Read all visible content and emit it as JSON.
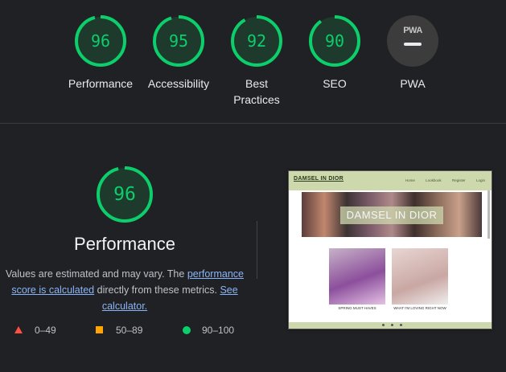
{
  "summary": {
    "categories": [
      {
        "label": "Performance",
        "score": "96",
        "value": 96
      },
      {
        "label": "Accessibility",
        "score": "95",
        "value": 95
      },
      {
        "label": "Best Practices",
        "score": "92",
        "value": 92
      },
      {
        "label": "SEO",
        "score": "90",
        "value": 90
      },
      {
        "label": "PWA",
        "badge": "PWA"
      }
    ]
  },
  "performance": {
    "score": "96",
    "value": 96,
    "title": "Performance",
    "desc_prefix": "Values are estimated and may vary. The ",
    "link1": "performance score is calculated",
    "desc_mid": " directly from these metrics. ",
    "link2": "See calculator."
  },
  "legend": {
    "fail": "0–49",
    "average": "50–89",
    "pass": "90–100"
  },
  "screenshot": {
    "brand": "DAMSEL IN DIOR",
    "nav_links": [
      "Home",
      "Lookbook",
      "Register",
      "Login"
    ],
    "hero_text": "DAMSEL IN DIOR",
    "card1_caption": "SPRING MUST HAVES",
    "card2_caption": "WHAT I'M LOVING RIGHT NOW"
  },
  "colors": {
    "pass": "#0cce6b",
    "average": "#ffa400",
    "fail": "#ff4e42",
    "link": "#8ab4f8"
  }
}
